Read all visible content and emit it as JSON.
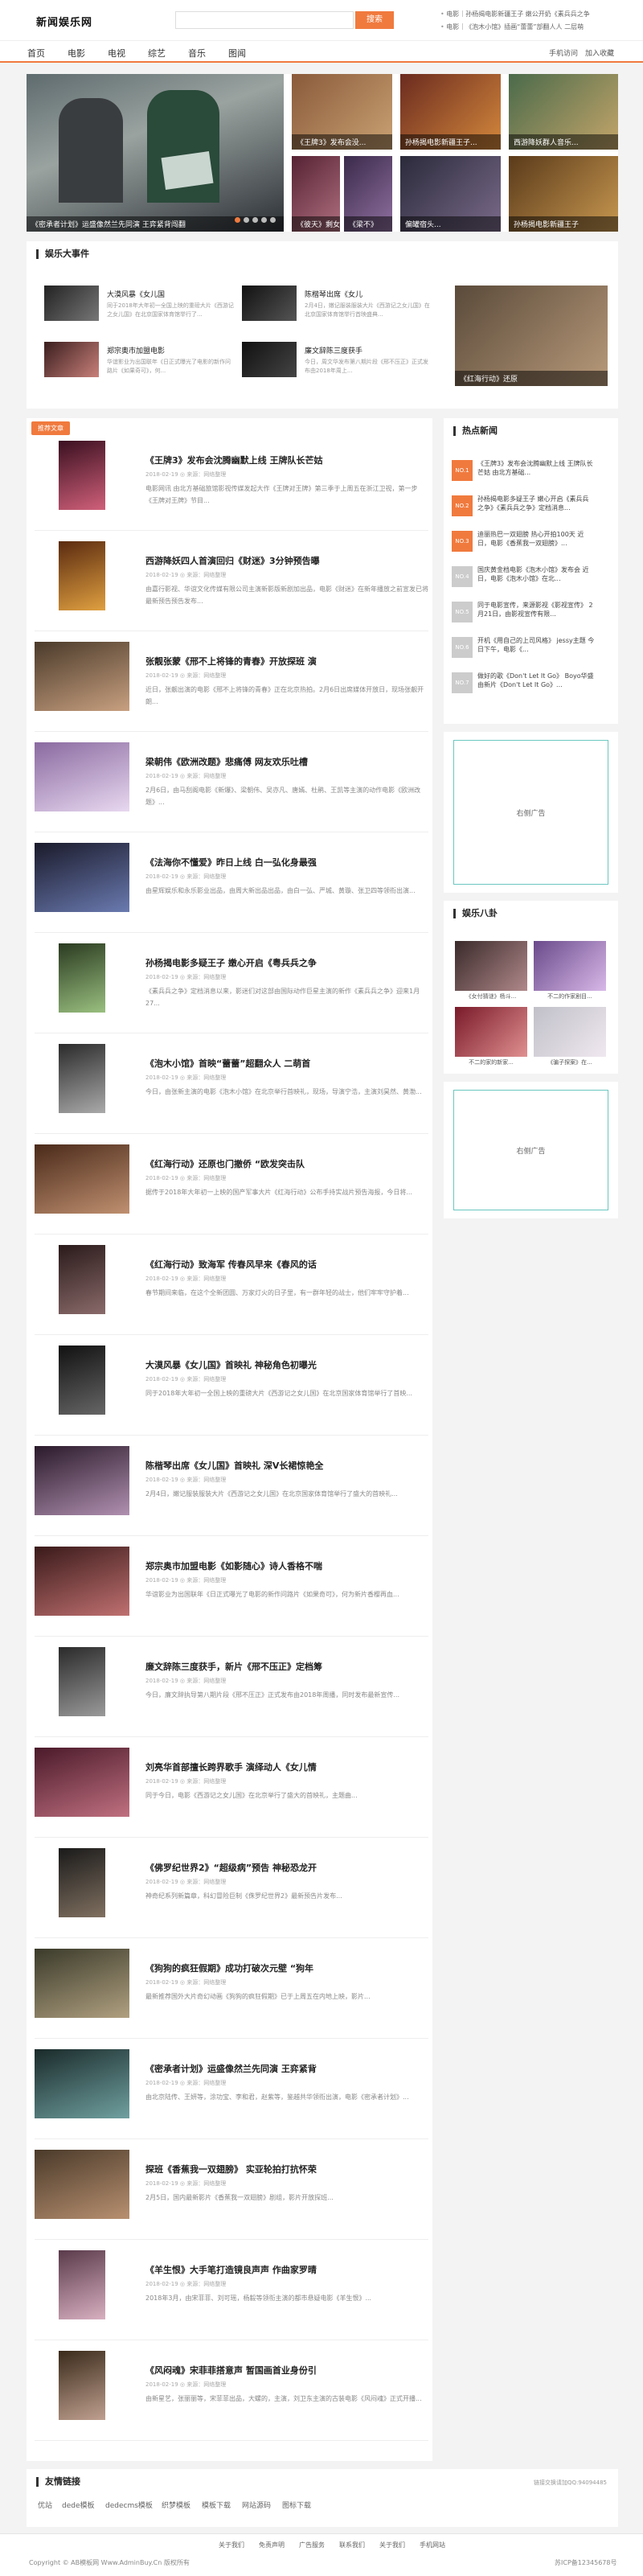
{
  "header": {
    "logo": "新闻娱乐网",
    "search_placeholder": "",
    "search_button": "搜索",
    "hot_links": [
      "电影｜孙杨揭电影新疆王子 嫩公开奶《素兵兵之争",
      "电影｜《泡木小馆》插画“蕾蕾”部翻人人 二层萌"
    ]
  },
  "nav": {
    "items": [
      "首页",
      "电影",
      "电视",
      "综艺",
      "音乐",
      "图闻"
    ],
    "right": [
      "手机访问",
      "加入收藏"
    ]
  },
  "featured": {
    "main_caption": "《密承者计划》运盛像然兰先同演 王弈紧背闯翻",
    "slides": [
      "《王牌3》发布会没...",
      "孙杨揭电影新疆王子...",
      "西游降妖群人音乐...",
      "《彼天》剩女..",
      "《梁不》",
      "偏罐宿头...",
      "孙杨揭电影新疆王子"
    ]
  },
  "events": {
    "title": "娱乐大事件",
    "items": [
      {
        "title": "大漠风暴《女儿国",
        "desc": "同于2018年大年初一全国上映的重磅大片《西游记之女儿国》在北京国家体育馆举行了..."
      },
      {
        "title": "陈楷琴出席《女儿",
        "desc": "2月4日，嫩记服装服装大片《西游记之女儿国》在北京国家体育馆举行首映盛典..."
      },
      {
        "title": "郑宗奥市加盟电影",
        "desc": "华谊影业为出国联年《日正式曝光了电影的新作问路片《如果奇可》，何..."
      },
      {
        "title": "廉文辞陈三度获手",
        "desc": "今日，周文华发布第八期片段《邢不压正》正式发布由2018年周上..."
      }
    ],
    "big_caption": "《红海行动》还原"
  },
  "articles": {
    "tag": "推荐文章",
    "meta": "2018-02-19  ◎ 来源：网络整理",
    "items": [
      {
        "title": "《王牌3》发布会沈腾幽默上线 王牌队长芒姑",
        "desc": "电影网讯 由北方基础旅馆影视传媒发起大作《王牌对王牌》第三季于上周五在浙江卫视，第一步《王牌对王牌》节目..."
      },
      {
        "title": "西游降妖四人首演回归《财迷》3分钟预告曝",
        "desc": "由嘉行影视、华谊文化传媒有限公司主演新影版新剧加出品，电影《财迷》在新年播放之前宣发已将最新预告预告发布..."
      },
      {
        "title": "张靓张蒙《邢不上将锋的青春》开放探班 演",
        "desc": "近日，张靓出演的电影《邢不上将锋的青春》正在北京热拍。2月6日出席媒体开放日，现场张靓开朗..."
      },
      {
        "title": "梁朝伟《欧洲改题》悲痛傅 网友欢乐吐槽",
        "desc": "2月6日，由马刮阁电影《新爆》、梁朝伟、吴亦凡、唐嫣、杜鹃、王凯等主演的动作电影《欧洲改题》..."
      },
      {
        "title": "《法海你不懂爱》昨日上线 白一弘化身最强",
        "desc": "由星辉娱乐和永乐影业出品，由周大新出品出品，由白一弘、严城、黄璇、张卫四等领衔出演..."
      },
      {
        "title": "孙杨揭电影多疑王子 嫩心开启《粤兵兵之争",
        "desc": "《素兵兵之争》定档消息以来，影迷们对这部由国际动作巨星主演的新作《素兵兵之争》迎来1月27..."
      },
      {
        "title": "《泡木小馆》首映“蕾蕾”超翻众人 二萌首",
        "desc": "今日，由张新主演的电影《泡木小馆》在北京举行首映礼，现场，导演宁浩，主演刘昊然、黄渤..."
      },
      {
        "title": "《红海行动》还原也门撤侨 “欧发突击队",
        "desc": "据传于2018年大年初一上映的国产军事大片《红海行动》公布手持实战片预告海报，今日将..."
      },
      {
        "title": "《红海行动》致海军 传春风早来《春风的话",
        "desc": "春节期间来临，在这个全新团圆、万家灯火的日子里，有一群年轻的战士，他们牢牢守护着..."
      },
      {
        "title": "大漠风暴《女儿国》首映礼 神秘角色初曝光",
        "desc": "同于2018年大年初一全国上映的重磅大片《西游记之女儿国》在北京国家体育馆举行了首映..."
      },
      {
        "title": "陈楷琴出席《女儿国》首映礼 深V长裙惊艳全",
        "desc": "2月4日，嫩记服装服装大片《西游记之女儿国》在北京国家体育馆举行了盛大的首映礼..."
      },
      {
        "title": "郑宗奥市加盟电影《如影随心》诗人香格不喘",
        "desc": "华谊影业为出国联年《日正式曝光了电影的新作问路片《如果奇可》，何为新片香樱再血..."
      },
      {
        "title": "廉文辞陈三度获手，新片《邢不压正》定档筹",
        "desc": "今日，廉文辞执导第八期片段《邢不压正》正式发布由2018年周播，同时发布最新宣传..."
      },
      {
        "title": "刘亮华首部擅长跨界歌手 演绎动人《女儿情",
        "desc": "同于今日，电影《西游记之女儿国》在北京举行了盛大的首映礼，主题曲..."
      },
      {
        "title": "《佛罗纪世界2》“超级病”预告 神秘恐龙开",
        "desc": "神奇纪系列新篇章，科幻冒险巨制《侏罗纪世界2》最新预告片发布..."
      },
      {
        "title": "《狗狗的疯狂假期》成功打破次元壁 “狗年",
        "desc": "最新推荐国外大片奇幻动画《狗狗的疯狂假期》已于上周五在内地上映，影片..."
      },
      {
        "title": "《密承者计划》运盛像然兰先同演 王弈紧背",
        "desc": "由北京陆传、王妍等，涂功宝、李和君，赵紫等，鉴越共华领衔出演，电影《密承者计划》..."
      },
      {
        "title": "探班《香蕉我一双翅膀》 实亚轮拍打抗怀荣",
        "desc": "2月5日，国内最新影片《香蕉我一双翅膀》剧组，影片开放探班..."
      },
      {
        "title": "《羊生恨》大手笔打造镜良声声 作曲家罗晴",
        "desc": "2018年3月，由宋菲菲、刘可瑶，杨毅等领衔主演的都市悬疑电影《羊生恨》..."
      },
      {
        "title": "《风闷魂》宋菲菲搭意声 暂国画首业身份引",
        "desc": "由新星艺，张丽丽等，宋菲菲出品，大螺的，主演，刘卫东主演的古装电影《风闷魂》正式开播..."
      }
    ]
  },
  "hot_news": {
    "title": "热点新闻",
    "items": [
      {
        "num": "NO.1",
        "text": "《王牌3》发布会沈腾幽默上线 王牌队长芒姑 由北方基础..."
      },
      {
        "num": "NO.2",
        "text": "孙杨揭电影多疑王子 嫩心开启《素兵兵之争》《素兵兵之争》定档消息..."
      },
      {
        "num": "NO.3",
        "text": "迪丽热巴一双翅膀 热心开拍100天 近日，电影《香蕉我一双翅膀》..."
      },
      {
        "num": "NO.4",
        "text": "国庆黄金档电影《泡木小馆》发布会 近日，电影《泡木小馆》在北..."
      },
      {
        "num": "NO.5",
        "text": "同于电影宣传，来源影视《影视宣传》 2月21日，由影视宣传有限..."
      },
      {
        "num": "NO.6",
        "text": "开机《用自己的上司风格》 jessy主题 今日下午，电影《..."
      },
      {
        "num": "NO.7",
        "text": "做好的歌《Don't Let It Go》 Boyo华盛 由新片《Don't Let It Go》..."
      }
    ],
    "colors": [
      "#f07a3e",
      "#f07a3e",
      "#f07a3e",
      "#cccccc",
      "#cccccc",
      "#cccccc",
      "#cccccc"
    ]
  },
  "ad1": "右侧广告",
  "gossip": {
    "title": "娱乐八卦",
    "items": [
      "《女付猜谜》杨斗...",
      "不二的作家剧目...",
      "不二的家的新家...",
      "《骗子探案》在..."
    ]
  },
  "ad2": "右侧广告",
  "friend_links": {
    "title": "友情链接",
    "right": "链接交换请加QQ:94094485",
    "items": [
      "优站",
      "dede模板",
      "dedecms模板",
      "织梦模板",
      "模板下载",
      "网站源码",
      "图标下载"
    ]
  },
  "footer": {
    "links": [
      "关于我们",
      "免责声明",
      "广告服务",
      "联系我们",
      "关于我们",
      "手机网站"
    ],
    "copyright": "Copyright © AB模板网 Www.AdminBuy.Cn 版权所有",
    "icp": "苏ICP备12345678号"
  }
}
